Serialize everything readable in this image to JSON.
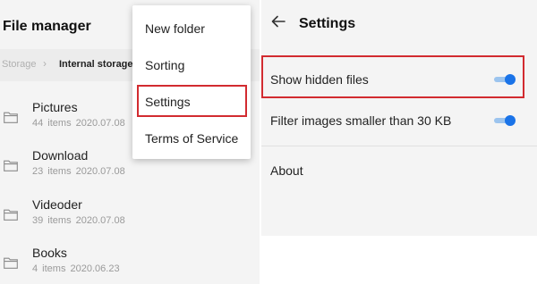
{
  "file_manager": {
    "title": "File manager",
    "breadcrumb": {
      "root": "Storage",
      "separator": "›",
      "current": "Internal storage"
    },
    "items": [
      {
        "name": "Pictures",
        "count": "44 items",
        "date": "2020.07.08",
        "icon": "folder-icon"
      },
      {
        "name": "Download",
        "count": "23 items",
        "date": "2020.07.08",
        "icon": "folder-icon"
      },
      {
        "name": "Videoder",
        "count": "39 items",
        "date": "2020.07.08",
        "icon": "folder-icon"
      },
      {
        "name": "Books",
        "count": "4 items",
        "date": "2020.06.23",
        "icon": "folder-icon"
      }
    ]
  },
  "menu": {
    "items": [
      "New folder",
      "Sorting",
      "Settings",
      "Terms of Service"
    ],
    "highlighted": "Settings"
  },
  "settings": {
    "title": "Settings",
    "back_icon": "back-arrow-icon",
    "options": [
      {
        "label": "Show hidden files",
        "toggle": true,
        "on": true,
        "highlighted": true
      },
      {
        "label": "Filter images smaller than 30 KB",
        "toggle": true,
        "on": true,
        "highlighted": false
      },
      {
        "label": "About",
        "toggle": false
      }
    ]
  },
  "colors": {
    "accent": "#1a73e8",
    "highlight_border": "#d22b30",
    "panel_bg": "#f4f4f4"
  }
}
